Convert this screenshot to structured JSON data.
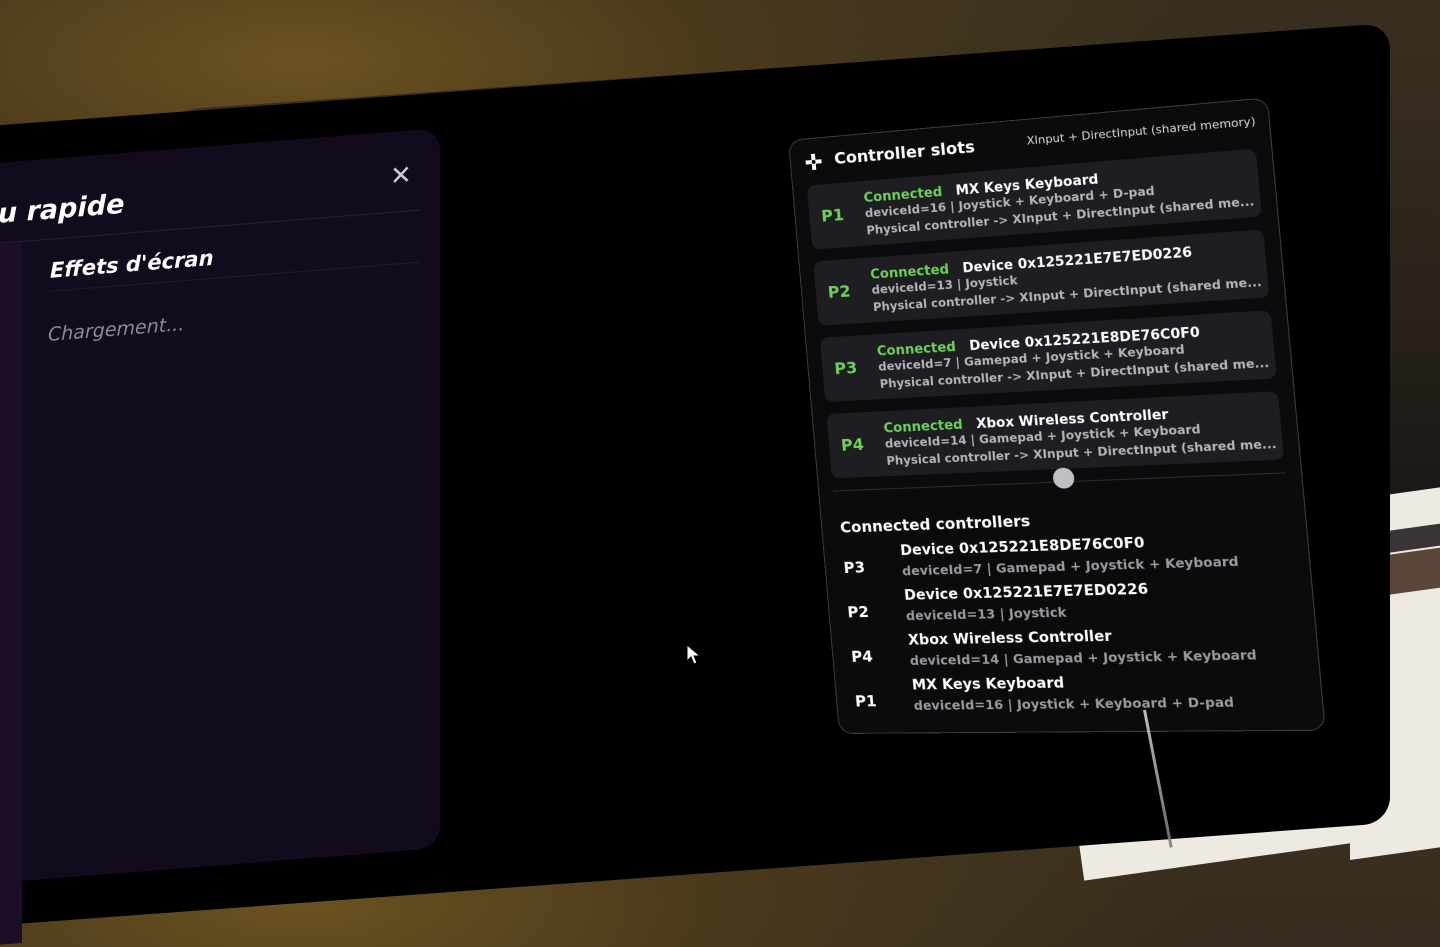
{
  "quick_menu": {
    "title": "u rapide",
    "close_icon": "close-icon",
    "section": "Effets d'écran",
    "loading": "Chargement..."
  },
  "slots_panel": {
    "title": "Controller slots",
    "subtitle": "XInput + DirectInput (shared memory)",
    "icon": "gamepad-icon",
    "slots": [
      {
        "id": "P1",
        "status": "Connected",
        "name": "MX Keys Keyboard",
        "meta": "deviceId=16 | Joystick + Keyboard + D-pad",
        "route": "Physical controller -> XInput + DirectInput (shared me..."
      },
      {
        "id": "P2",
        "status": "Connected",
        "name": "Device 0x125221E7E7ED0226",
        "meta": "deviceId=13 | Joystick",
        "route": "Physical controller -> XInput + DirectInput (shared me..."
      },
      {
        "id": "P3",
        "status": "Connected",
        "name": "Device 0x125221E8DE76C0F0",
        "meta": "deviceId=7 | Gamepad + Joystick + Keyboard",
        "route": "Physical controller -> XInput + DirectInput (shared me..."
      },
      {
        "id": "P4",
        "status": "Connected",
        "name": "Xbox Wireless Controller",
        "meta": "deviceId=14 | Gamepad + Joystick + Keyboard",
        "route": "Physical controller -> XInput + DirectInput (shared me..."
      }
    ],
    "connected_title": "Connected controllers",
    "connected": [
      {
        "id": "P3",
        "name": "Device 0x125221E8DE76C0F0",
        "meta": "deviceId=7 | Gamepad + Joystick + Keyboard"
      },
      {
        "id": "P2",
        "name": "Device 0x125221E7E7ED0226",
        "meta": "deviceId=13 | Joystick"
      },
      {
        "id": "P4",
        "name": "Xbox Wireless Controller",
        "meta": "deviceId=14 | Gamepad + Joystick + Keyboard"
      },
      {
        "id": "P1",
        "name": "MX Keys Keyboard",
        "meta": "deviceId=16 | Joystick + Keyboard + D-pad"
      }
    ]
  },
  "colors": {
    "connected_green": "#6cd05a",
    "panel_bg": "#0b0b0d",
    "slot_bg": "#1e1e22",
    "quick_menu_bg": "#140a1e"
  }
}
